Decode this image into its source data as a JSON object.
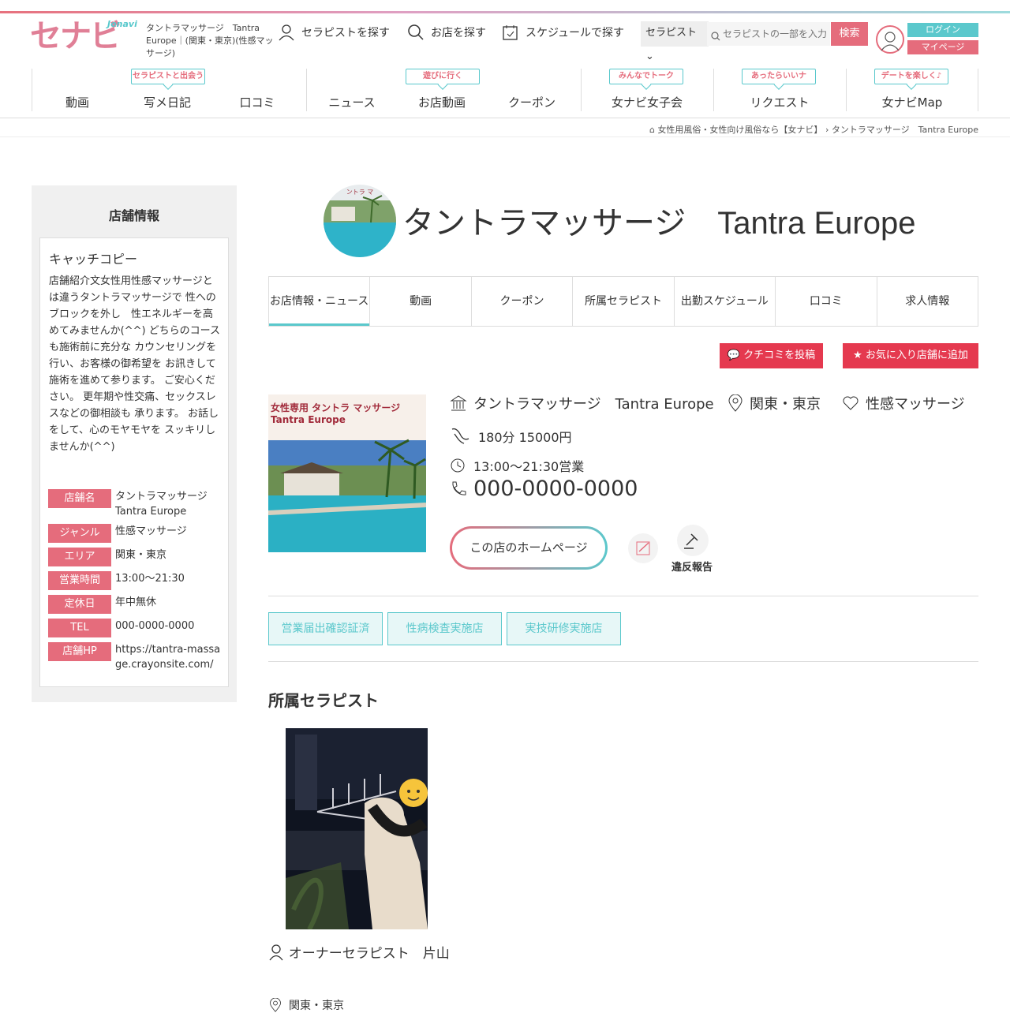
{
  "header": {
    "logo": "セナビ",
    "logo_sub": "Jonavi",
    "shop_desc": "タントラマッサージ　Tantra Europe｜(関東・東京)(性感マッサージ)",
    "nav_therapist": "セラピストを探す",
    "nav_shop": "お店を探す",
    "nav_schedule": "スケジュールで探す",
    "search_select": "セラピスト",
    "search_placeholder": "セラピストの一部を入力",
    "search_button": "検索",
    "login": "ログイン",
    "mypage": "マイページ"
  },
  "mainnav": {
    "items": [
      {
        "label": "動画"
      },
      {
        "label": "写メ日記",
        "bubble": "セラピストと出会う"
      },
      {
        "label": "口コミ"
      },
      {
        "label": "ニュース"
      },
      {
        "label": "お店動画",
        "bubble": "遊びに行く"
      },
      {
        "label": "クーポン"
      },
      {
        "label": "女ナビ女子会",
        "bubble": "みんなでトーク"
      },
      {
        "label": "リクエスト",
        "bubble": "あったらいいナ"
      },
      {
        "label": "女ナビMap",
        "bubble": "デートを楽しく♪"
      }
    ]
  },
  "breadcrumb": {
    "home": "女性用風俗・女性向け風俗なら【女ナビ】",
    "current": "タントラマッサージ　Tantra Europe"
  },
  "sidebar": {
    "title": "店舗情報",
    "catch_label": "キャッチコピー",
    "catch_text": "店舗紹介文女性用性感マッサージとは違うタントラマッサージで 性へのブロックを外し　性エネルギーを高めてみませんか(^^) どちらのコースも施術前に充分な カウンセリングを行い、お客様の御希望を お訊きして施術を進めて参ります。 ご安心ください。 更年期や性交痛、セックスレスなどの御相談も 承ります。 お話しをして、心のモヤモヤを スッキリしませんか(^^)",
    "rows": [
      {
        "label": "店舗名",
        "value": "タントラマッサージ Tantra Europe"
      },
      {
        "label": "ジャンル",
        "value": "性感マッサージ"
      },
      {
        "label": "エリア",
        "value": "関東・東京"
      },
      {
        "label": "営業時間",
        "value": "13:00〜21:30"
      },
      {
        "label": "定休日",
        "value": "年中無休"
      },
      {
        "label": "TEL",
        "value": "000-0000-0000"
      },
      {
        "label": "店舗HP",
        "value": "https://tantra-massage.crayonsite.com/"
      }
    ]
  },
  "main": {
    "shop_title": "タントラマッサージ　Tantra Europe",
    "tabs": [
      "お店情報・ニュース",
      "動画",
      "クーポン",
      "所属セラピスト",
      "出勤スケジュール",
      "口コミ",
      "求人情報"
    ],
    "post_review": "クチコミを投稿",
    "add_favorite": "お気に入り店舗に追加",
    "image_caption_1": "女性専用 タントラ マッサージ",
    "image_caption_2": "Tantra Europe",
    "icon_caption": "ントラ マ",
    "info_name": "タントラマッサージ　Tantra Europe",
    "info_area": "関東・東京",
    "info_genre": "性感マッサージ",
    "info_price": "180分  15000円",
    "info_hours": "13:00〜21:30営業",
    "info_tel": "000-0000-0000",
    "homepage_button": "この店のホームページ",
    "report": "違反報告",
    "certs": [
      "営業届出確認証済",
      "性病検査実施店",
      "実技研修実施店"
    ],
    "therapist_section": "所属セラピスト",
    "therapist_name": "オーナーセラピスト　片山",
    "therapist_area": "関東・東京"
  },
  "colors": {
    "accent_pink": "#e56c7c",
    "accent_teal": "#5bc8cc",
    "red": "#e5394f"
  }
}
